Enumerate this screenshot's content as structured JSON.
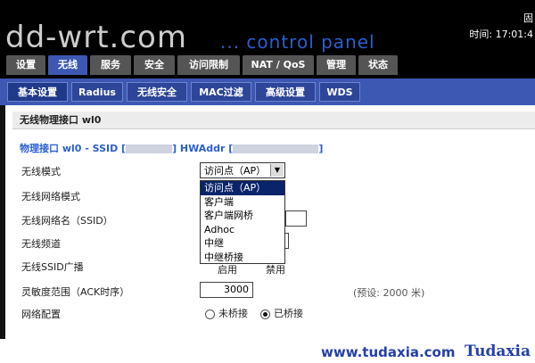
{
  "header": {
    "logo": "dd-wrt.com",
    "tagline": "... control panel",
    "right_line1": "固",
    "right_line2": "时间: 17:01:4"
  },
  "main_tabs": [
    {
      "label": "设置"
    },
    {
      "label": "无线"
    },
    {
      "label": "服务"
    },
    {
      "label": "安全"
    },
    {
      "label": "访问限制"
    },
    {
      "label": "NAT / QoS"
    },
    {
      "label": "管理"
    },
    {
      "label": "状态"
    }
  ],
  "sub_tabs": [
    {
      "label": "基本设置"
    },
    {
      "label": "Radius"
    },
    {
      "label": "无线安全"
    },
    {
      "label": "MAC过滤"
    },
    {
      "label": "高级设置"
    },
    {
      "label": "WDS"
    }
  ],
  "section": {
    "title": "无线物理接口 wl0",
    "subhead_prefix": "物理接口 wl0 - SSID [",
    "subhead_mid": "] HWAddr [",
    "subhead_suffix": "]"
  },
  "form": {
    "mode_label": "无线模式",
    "mode_value": "访问点（AP）",
    "netmode_label": "无线网络模式",
    "ssid_label": "无线网络名（SSID）",
    "channel_label": "无线频道",
    "broadcast_label": "无线SSID广播",
    "broadcast_enable": "启用",
    "broadcast_disable": "禁用",
    "ack_label": "灵敏度范围（ACK时序）",
    "ack_value": "3000",
    "ack_hint": "(预设: 2000 米)",
    "netconfig_label": "网络配置",
    "unbridged": "未桥接",
    "bridged": "已桥接"
  },
  "dropdown_options": [
    {
      "label": "访问点（AP）"
    },
    {
      "label": "客户端"
    },
    {
      "label": "客户端网桥"
    },
    {
      "label": "Adhoc"
    },
    {
      "label": "中继"
    },
    {
      "label": "中继桥接"
    }
  ],
  "watermark": {
    "url": "www.tudaxia.com",
    "brand": "Tudaxia"
  }
}
